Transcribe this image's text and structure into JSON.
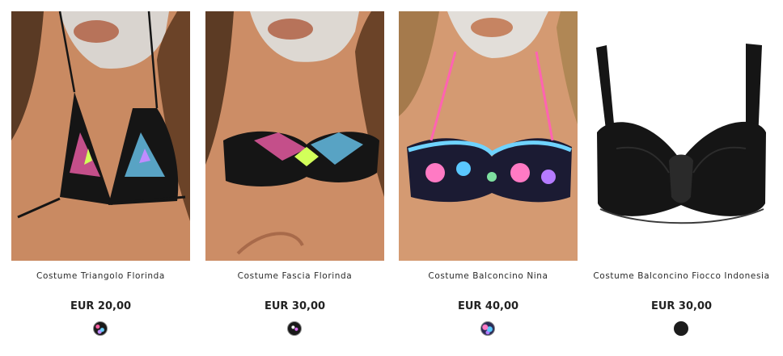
{
  "products": [
    {
      "name": "Costume Triangolo Florinda",
      "price": "EUR 20,00",
      "swatch": "multicolor-print",
      "image": "model-triangle-bikini-top-tribal-print"
    },
    {
      "name": "Costume Fascia Florinda",
      "price": "EUR 30,00",
      "swatch": "black-white-print",
      "image": "model-bandeau-bikini-top-tribal-print"
    },
    {
      "name": "Costume Balconcino Nina",
      "price": "EUR 40,00",
      "swatch": "floral-print",
      "image": "model-balconette-bikini-top-floral"
    },
    {
      "name": "Costume Balconcino Fiocco Indonesia",
      "price": "EUR 30,00",
      "swatch": "black",
      "image": "product-black-balconette-bow-top"
    }
  ],
  "colors": {
    "black_fabric": "#151515",
    "skin": "#c98a62",
    "background": "#ffffff",
    "text": "#222222"
  }
}
